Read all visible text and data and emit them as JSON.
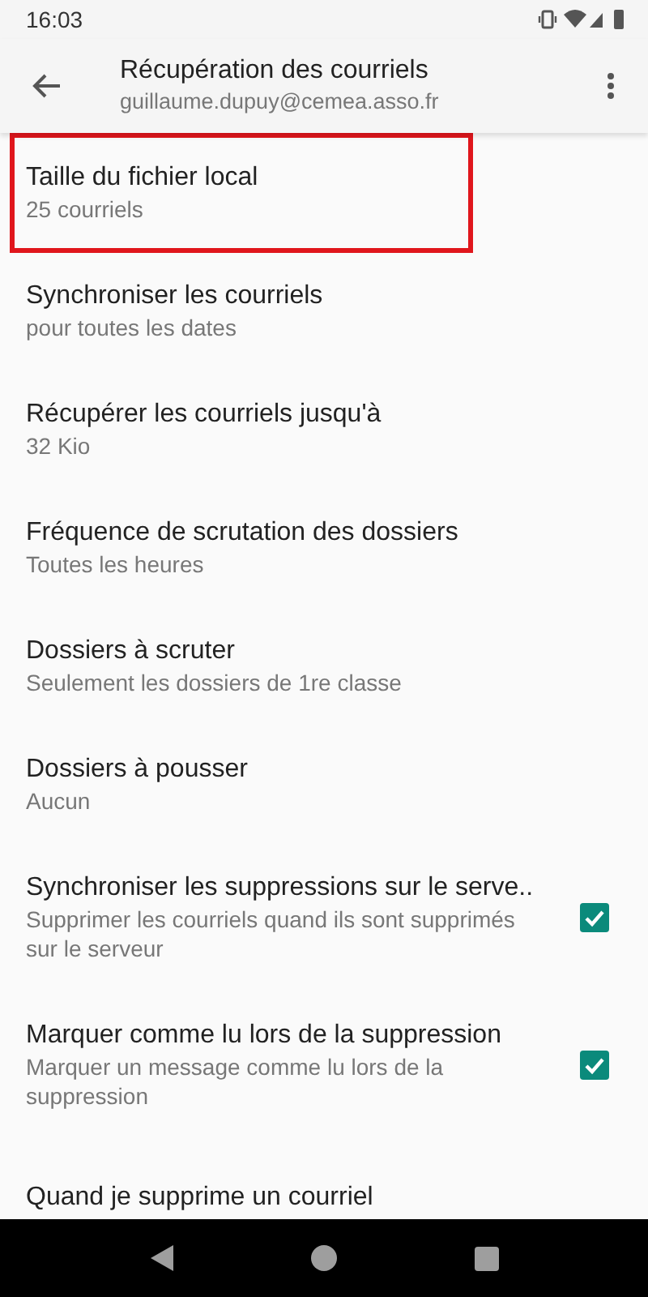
{
  "status_bar": {
    "time": "16:03"
  },
  "app_bar": {
    "title": "Récupération des courriels",
    "subtitle": "guillaume.dupuy@cemea.asso.fr"
  },
  "settings": [
    {
      "kind": "text",
      "title": "Taille du fichier local",
      "summary": "25 courriels",
      "highlighted": true
    },
    {
      "kind": "text",
      "title": "Synchroniser les courriels",
      "summary": "pour toutes les dates",
      "highlighted": false
    },
    {
      "kind": "text",
      "title": "Récupérer les courriels jusqu'à",
      "summary": "32 Kio",
      "highlighted": false
    },
    {
      "kind": "text",
      "title": "Fréquence de scrutation des dossiers",
      "summary": "Toutes les heures",
      "highlighted": false
    },
    {
      "kind": "text",
      "title": "Dossiers à scruter",
      "summary": "Seulement les dossiers de 1re classe",
      "highlighted": false
    },
    {
      "kind": "text",
      "title": "Dossiers à pousser",
      "summary": "Aucun",
      "highlighted": false
    },
    {
      "kind": "checkbox",
      "title": "Synchroniser les suppressions sur le serve..",
      "summary": "Supprimer les courriels quand ils sont supprimés sur le serveur",
      "checked": true,
      "highlighted": false
    },
    {
      "kind": "checkbox",
      "title": "Marquer comme lu lors de la suppression",
      "summary": "Marquer un message comme lu lors de la suppression",
      "checked": true,
      "highlighted": false
    },
    {
      "kind": "text",
      "title": "Quand je supprime un courriel",
      "highlighted": false
    }
  ]
}
